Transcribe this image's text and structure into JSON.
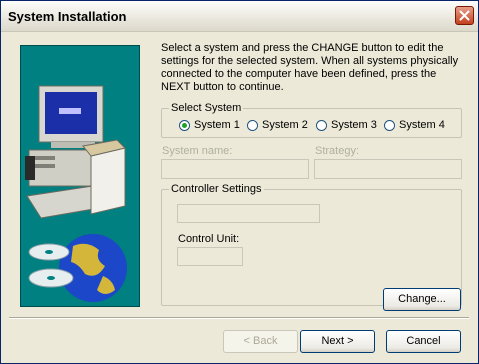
{
  "window": {
    "title": "System Installation"
  },
  "instructions": "Select a system and press the CHANGE button to edit the settings for the selected system. When all systems physically connected to the computer have been defined, press the NEXT button to continue.",
  "select_system": {
    "label": "Select System",
    "options": [
      "System 1",
      "System 2",
      "System 3",
      "System 4"
    ],
    "selected": "System 1"
  },
  "fields": {
    "system_name_label": "System name:",
    "system_name_value": "",
    "strategy_label": "Strategy:",
    "strategy_value": ""
  },
  "controller": {
    "label": "Controller Settings",
    "controller_value": "",
    "control_unit_label": "Control Unit:",
    "control_unit_value": ""
  },
  "buttons": {
    "change": "Change...",
    "back": "< Back",
    "next": "Next >",
    "cancel": "Cancel"
  },
  "colors": {
    "art_background": "#008080",
    "close_button": "#c2401f"
  }
}
